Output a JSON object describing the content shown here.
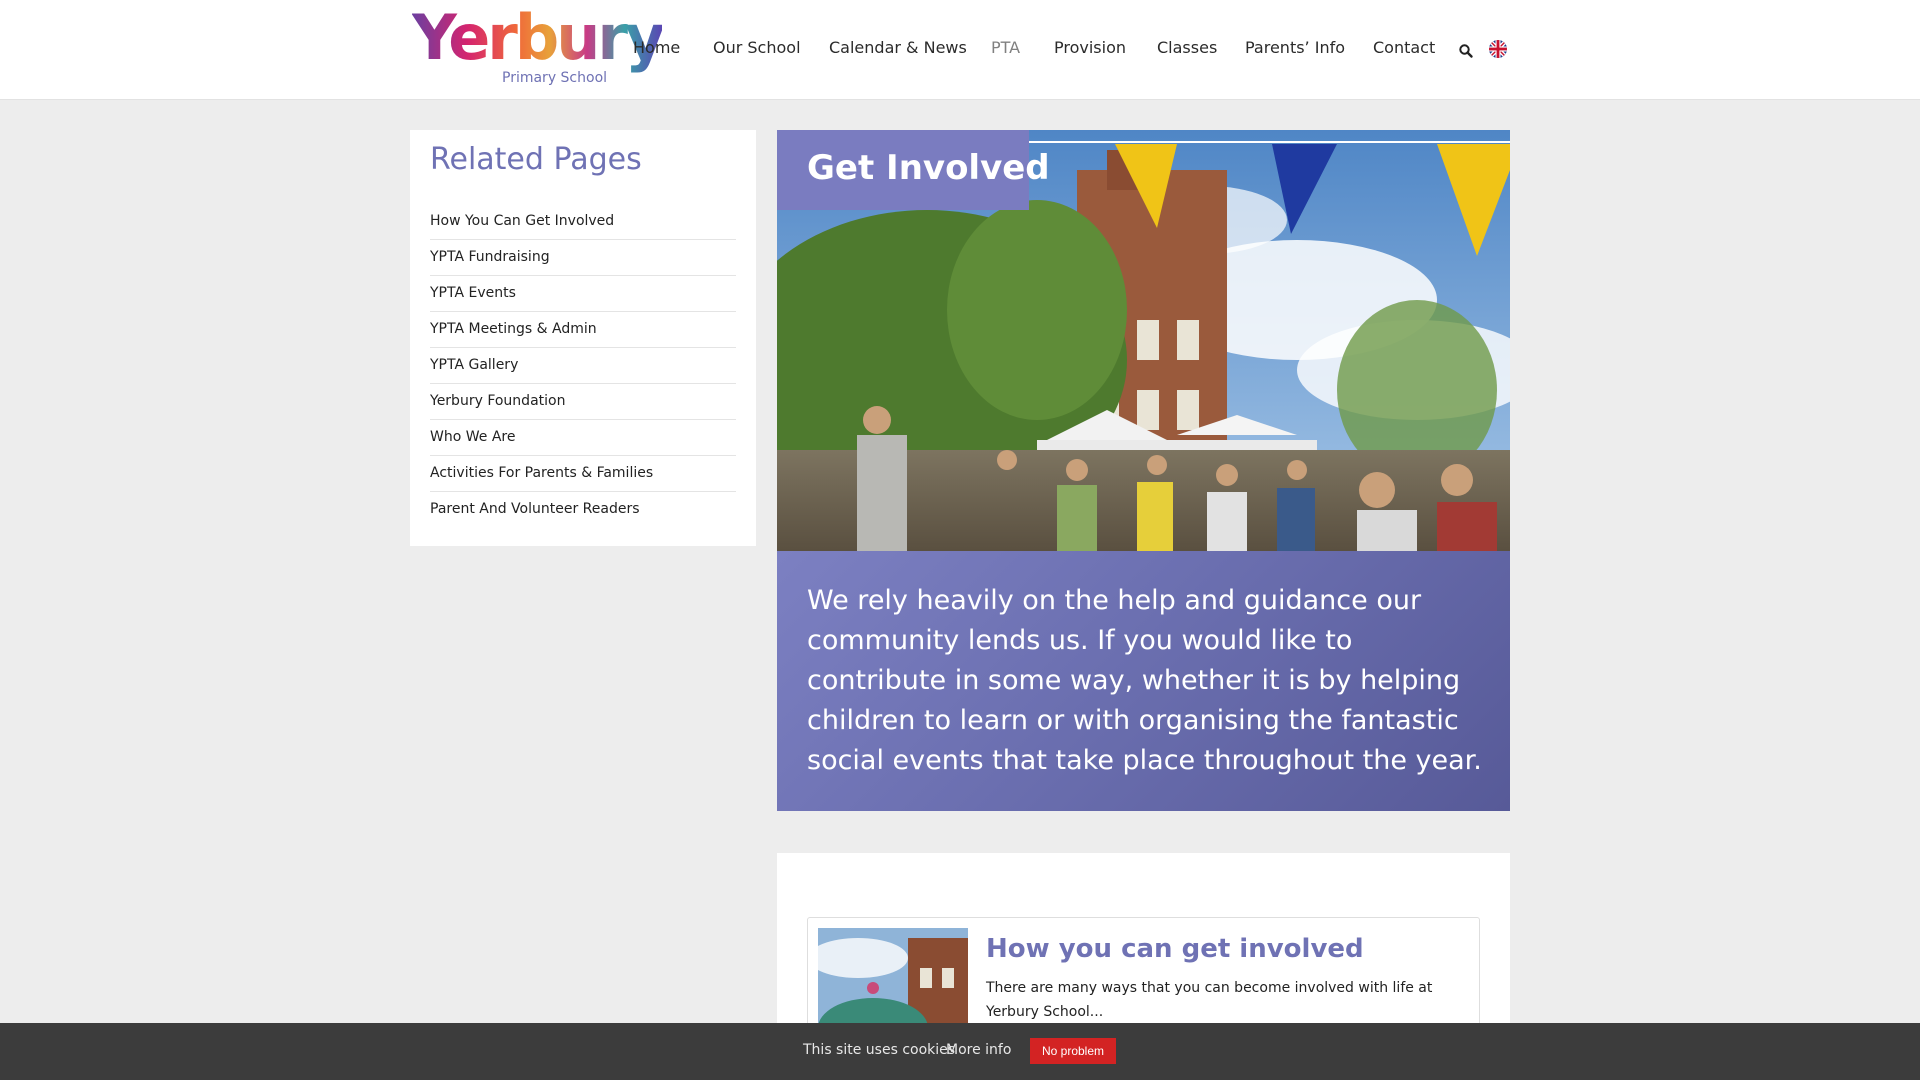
{
  "header": {
    "logo_word": "Yerbury",
    "logo_subtitle": "Primary School",
    "nav": [
      {
        "label": "Home"
      },
      {
        "label": "Our School"
      },
      {
        "label": "Calendar & News"
      },
      {
        "label": "PTA",
        "active": true
      },
      {
        "label": "Provision"
      },
      {
        "label": "Classes"
      },
      {
        "label": "Parents’ Info"
      },
      {
        "label": "Contact"
      }
    ],
    "icons": [
      "search-icon",
      "uk-flag-icon"
    ]
  },
  "sidebar": {
    "title": "Related Pages",
    "items": [
      {
        "label": "How You Can Get Involved"
      },
      {
        "label": "YPTA Fundraising"
      },
      {
        "label": "YPTA Events"
      },
      {
        "label": "YPTA Meetings & Admin"
      },
      {
        "label": "YPTA Gallery"
      },
      {
        "label": "Yerbury Foundation"
      },
      {
        "label": "Who We Are"
      },
      {
        "label": "Activities For Parents & Families"
      },
      {
        "label": "Parent And Volunteer Readers"
      }
    ]
  },
  "hero": {
    "title": "Get Involved",
    "intro": "We rely heavily on the help and guidance our community lends us. If you would like to contribute in some way, whether it is by helping children to learn or with organising the fantastic social events that take place throughout the year."
  },
  "card": {
    "title": "How you can get involved",
    "text": "There are many ways that you can become involved with life at Yerbury School..."
  },
  "cookie": {
    "text": "This site uses cookies",
    "more": "More info",
    "button": "No problem"
  },
  "colors": {
    "accent": "#6f72b4",
    "title_box": "#7a7cc0",
    "cookie_bar": "#3c3c3c",
    "cookie_button": "#d32323"
  }
}
